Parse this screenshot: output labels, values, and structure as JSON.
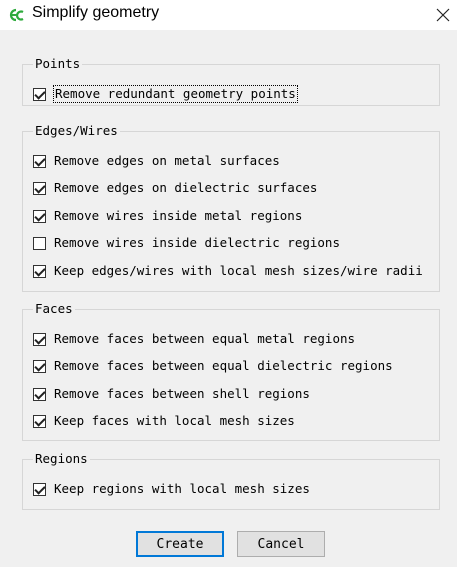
{
  "window": {
    "title": "Simplify geometry"
  },
  "groups": {
    "points": {
      "title": "Points",
      "items": [
        {
          "label": "Remove redundant geometry points",
          "checked": true
        }
      ]
    },
    "edges": {
      "title": "Edges/Wires",
      "items": [
        {
          "label": "Remove edges on metal surfaces",
          "checked": true
        },
        {
          "label": "Remove edges on dielectric surfaces",
          "checked": true
        },
        {
          "label": "Remove wires inside metal regions",
          "checked": true
        },
        {
          "label": "Remove wires inside dielectric regions",
          "checked": false
        },
        {
          "label": "Keep edges/wires with local mesh sizes/wire radii",
          "checked": true
        }
      ]
    },
    "faces": {
      "title": "Faces",
      "items": [
        {
          "label": "Remove faces between equal metal regions",
          "checked": true
        },
        {
          "label": "Remove faces between equal dielectric regions",
          "checked": true
        },
        {
          "label": "Remove faces between shell regions",
          "checked": true
        },
        {
          "label": "Keep faces with local mesh sizes",
          "checked": true
        }
      ]
    },
    "regions": {
      "title": "Regions",
      "items": [
        {
          "label": "Keep regions with local mesh sizes",
          "checked": true
        }
      ]
    }
  },
  "buttons": {
    "create": "Create",
    "cancel": "Cancel"
  },
  "colors": {
    "accent": "#0078d7",
    "icon_green": "#2eaa3c"
  }
}
